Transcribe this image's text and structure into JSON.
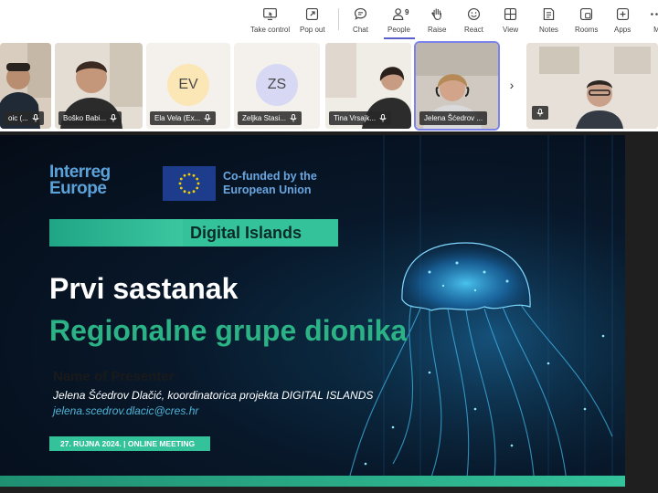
{
  "toolbar": {
    "items": [
      {
        "label": "Take control",
        "icon": "take-control-icon"
      },
      {
        "label": "Pop out",
        "icon": "pop-out-icon"
      },
      {
        "label": "Chat",
        "icon": "chat-icon"
      },
      {
        "label": "People",
        "icon": "people-icon",
        "badge": "9",
        "active": true
      },
      {
        "label": "Raise",
        "icon": "raise-hand-icon"
      },
      {
        "label": "React",
        "icon": "react-icon"
      },
      {
        "label": "View",
        "icon": "view-icon"
      },
      {
        "label": "Notes",
        "icon": "notes-icon"
      },
      {
        "label": "Rooms",
        "icon": "rooms-icon"
      },
      {
        "label": "Apps",
        "icon": "apps-icon"
      },
      {
        "label": "M",
        "icon": "more-icon"
      }
    ]
  },
  "participants": [
    {
      "name": "oic (...",
      "type": "video"
    },
    {
      "name": "Boško Babi...",
      "type": "video"
    },
    {
      "name": "Ela Vela (Ex...",
      "type": "initials",
      "initials": "EV",
      "avatar_color": "#fbe6b6"
    },
    {
      "name": "Zeljka Stasi...",
      "type": "initials",
      "initials": "ZS",
      "avatar_color": "#d7d8f4"
    },
    {
      "name": "Tina Vrsajk...",
      "type": "video"
    },
    {
      "name": "Jelena Šćedrov ...",
      "type": "video",
      "active": true
    },
    {
      "name": "",
      "type": "video"
    }
  ],
  "slide": {
    "logo": "Interreg Europe",
    "cofunded": "Co-funded by the European Union",
    "banner": "Digital Islands",
    "title_line1": "Prvi sastanak",
    "title_line2": "Regionalne grupe dionika",
    "presenter_label": "Name of Presenter",
    "presenter_name": "Jelena Šćedrov Dlačić, koordinatorica projekta DIGITAL ISLANDS",
    "presenter_email": "jelena.scedrov.dlacic@cres.hr",
    "date_line": "27. RUJNA 2024. | ONLINE MEETING"
  },
  "colors": {
    "accent_purple": "#5b5fc7",
    "slide_green": "#33c29a",
    "title_green": "#2bb386",
    "slide_bg": "#08182a"
  }
}
